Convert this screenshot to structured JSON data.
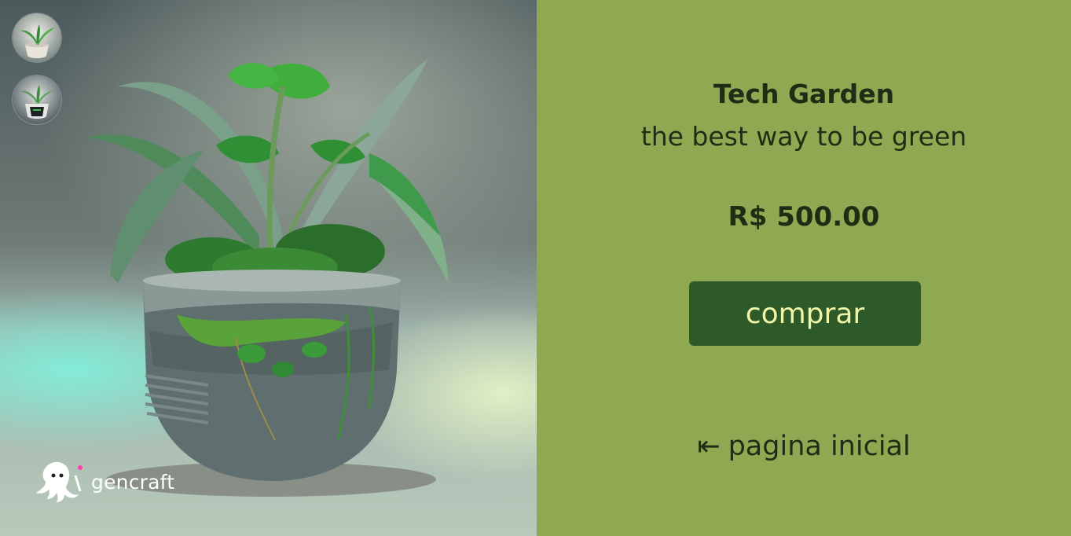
{
  "product": {
    "title": "Tech Garden",
    "subtitle": "the best way to be green",
    "price": "R$ 500.00"
  },
  "actions": {
    "buy_label": "comprar",
    "home_arrow": "⇤",
    "home_label": "pagina inicial"
  },
  "gallery": {
    "thumbnails": [
      "plant-pot-thumbnail",
      "plant-pot-thumbnail-dark"
    ]
  },
  "watermark": {
    "brand": "gencraft",
    "icon": "octopus-logo-icon"
  },
  "colors": {
    "panel_bg": "#8fa852",
    "text": "#1d2e14",
    "button_bg": "#2e5a2a",
    "button_text": "#f1f5a8"
  }
}
